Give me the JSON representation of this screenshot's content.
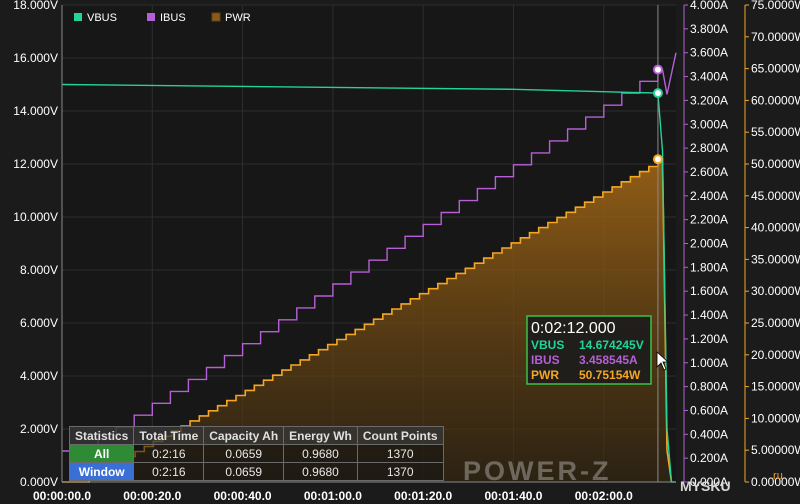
{
  "chart_data": {
    "type": "line",
    "x_unit": "seconds",
    "x_tick_labels": [
      "00:00:00.0",
      "00:00:20.0",
      "00:00:40.0",
      "00:01:00.0",
      "00:01:20.0",
      "00:01:40.0",
      "00:02:00.0"
    ],
    "x_range": [
      0,
      136
    ],
    "axes": {
      "left": {
        "unit": "V",
        "range": [
          0,
          18
        ],
        "tick_labels": [
          "0.000V",
          "2.000V",
          "4.000V",
          "6.000V",
          "8.000V",
          "10.000V",
          "12.000V",
          "14.000V",
          "16.000V",
          "18.000V"
        ]
      },
      "right1": {
        "unit": "A",
        "range": [
          0,
          4
        ],
        "tick_labels": [
          "0.000A",
          "0.200A",
          "0.400A",
          "0.600A",
          "0.800A",
          "1.000A",
          "1.200A",
          "1.400A",
          "1.600A",
          "1.800A",
          "2.000A",
          "2.200A",
          "2.400A",
          "2.600A",
          "2.800A",
          "3.000A",
          "3.200A",
          "3.400A",
          "3.600A",
          "3.800A",
          "4.000A"
        ]
      },
      "right2": {
        "unit": "W",
        "range": [
          0,
          75
        ],
        "tick_labels": [
          "0.00000W",
          "5.00000W",
          "10.0000W",
          "15.0000W",
          "20.0000W",
          "25.0000W",
          "30.0000W",
          "35.0000W",
          "40.0000W",
          "45.0000W",
          "50.0000W",
          "55.0000W",
          "60.0000W",
          "65.0000W",
          "70.0000W",
          "75.0000W"
        ]
      }
    },
    "series": [
      {
        "name": "VBUS",
        "color": "#22d39a",
        "axis": "left",
        "x": [
          0,
          100,
          132,
          133,
          134,
          135,
          136
        ],
        "y": [
          15.0,
          14.82,
          14.674245,
          12.5,
          2.0,
          0.0,
          0.0
        ]
      },
      {
        "name": "IBUS",
        "color": "#b65fd6",
        "axis": "right1",
        "step": {
          "start_x": 4,
          "start_y": 0.26,
          "step_x": 4.0,
          "step_y": 0.1,
          "end_x": 132,
          "end_y": 3.458545
        },
        "x": [
          0,
          4,
          132,
          133,
          134,
          136
        ],
        "y": [
          0.26,
          0.26,
          3.458545,
          3.458545,
          3.25,
          3.6
        ]
      },
      {
        "name": "PWR",
        "color": "#f5a623",
        "axis": "right2",
        "step": {
          "start_x": 4,
          "start_y": 0.0,
          "step_x": 2.0,
          "step_y": 0.8,
          "end_x": 132,
          "end_y": 50.75154
        },
        "fill": true,
        "x": [
          0,
          132,
          133,
          134,
          135
        ],
        "y": [
          0,
          50.75154,
          50.75154,
          5.0,
          0.0
        ]
      }
    ],
    "legend": {
      "placement": "top-left",
      "entries": [
        "VBUS",
        "IBUS",
        "PWR"
      ]
    },
    "cursor": {
      "x": 132,
      "time": "0:02:12.000",
      "values": [
        {
          "label": "VBUS",
          "value": "14.674245V"
        },
        {
          "label": "IBUS",
          "value": "3.458545A"
        },
        {
          "label": "PWR",
          "value": "50.75154W"
        }
      ]
    }
  },
  "stats": {
    "headers": [
      "Statistics",
      "Total Time",
      "Capacity Ah",
      "Energy Wh",
      "Count Points"
    ],
    "rows": [
      {
        "label": "All",
        "total_time": "0:2:16",
        "capacity": "0.0659",
        "energy": "0.9680",
        "count": "1370"
      },
      {
        "label": "Window",
        "total_time": "0:2:16",
        "capacity": "0.0659",
        "energy": "0.9680",
        "count": "1370"
      }
    ]
  },
  "logo_text": "POWER-Z",
  "watermark": "MYSKU",
  "watermark_suffix": ".ru"
}
